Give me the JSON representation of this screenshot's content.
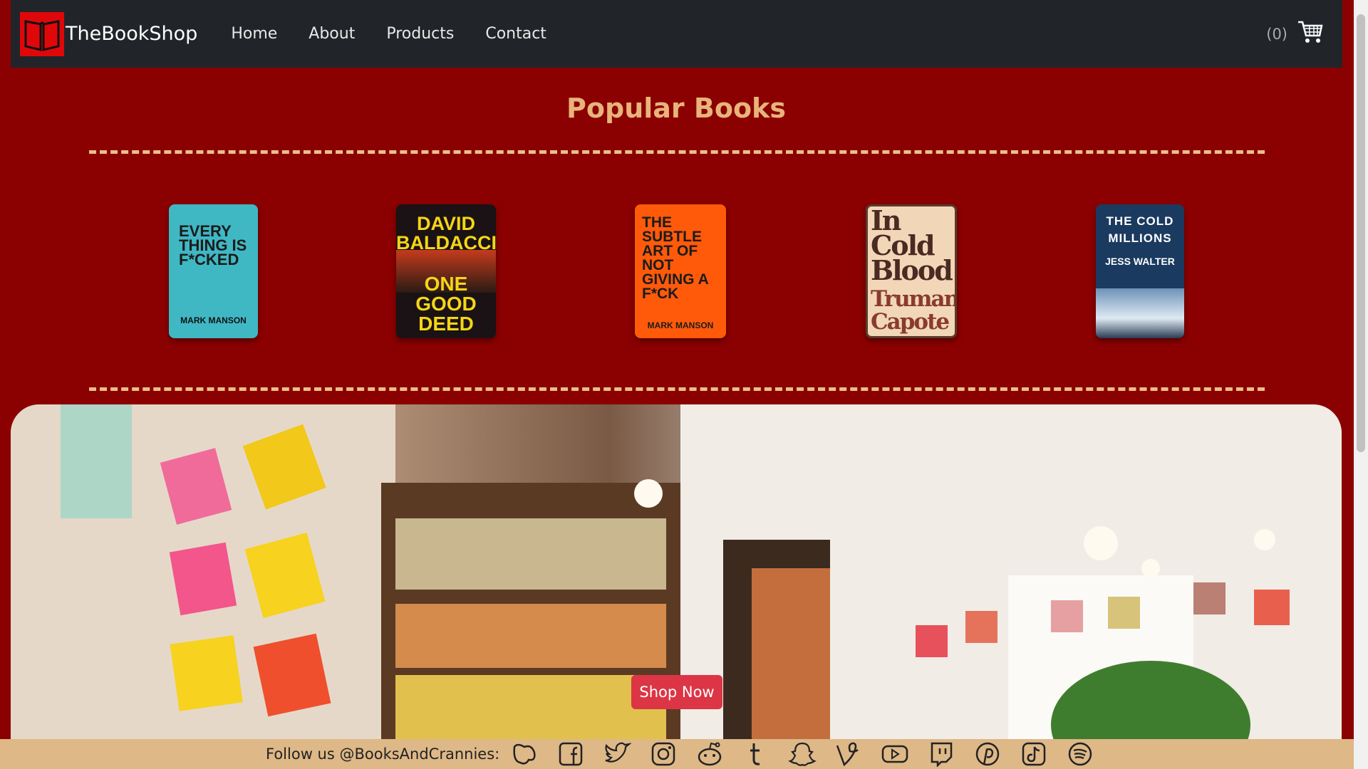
{
  "navbar": {
    "brand": "TheBookShop",
    "links": [
      "Home",
      "About",
      "Products",
      "Contact"
    ],
    "cart_count": "(0)"
  },
  "popular": {
    "title": "Popular Books",
    "books": [
      {
        "title": "EVERY THING IS F*CKED",
        "author": "MARK MANSON",
        "color": "#3fb8c4"
      },
      {
        "title": "ONE GOOD DEED",
        "author": "DAVID BALDACCI",
        "color": "#1a1214"
      },
      {
        "title": "THE SUBTLE ART OF NOT GIVING A F*CK",
        "author": "MARK MANSON",
        "color": "#ff5a0a"
      },
      {
        "title": "In Cold Blood",
        "author": "Truman Capote",
        "color": "#f1d7b7"
      },
      {
        "title": "THE COLD MILLIONS",
        "author": "JESS WALTER",
        "color": "#1b3a5f"
      }
    ]
  },
  "hero": {
    "button_label": "Shop Now",
    "image": "bookshop-interior-photo"
  },
  "footer": {
    "follow_text": "Follow us @BooksAndCrannies:",
    "icons": [
      "meetup-icon",
      "facebook-icon",
      "twitter-icon",
      "instagram-icon",
      "reddit-icon",
      "tumblr-icon",
      "snapchat-icon",
      "vine-icon",
      "youtube-icon",
      "twitch-icon",
      "pinterest-icon",
      "tiktok-icon",
      "spotify-icon"
    ]
  },
  "colors": {
    "page_bg": "#8b0000",
    "navbar_bg": "#212529",
    "title": "#e8b47a",
    "button": "#dc3545",
    "footer_bg": "#deb887"
  }
}
